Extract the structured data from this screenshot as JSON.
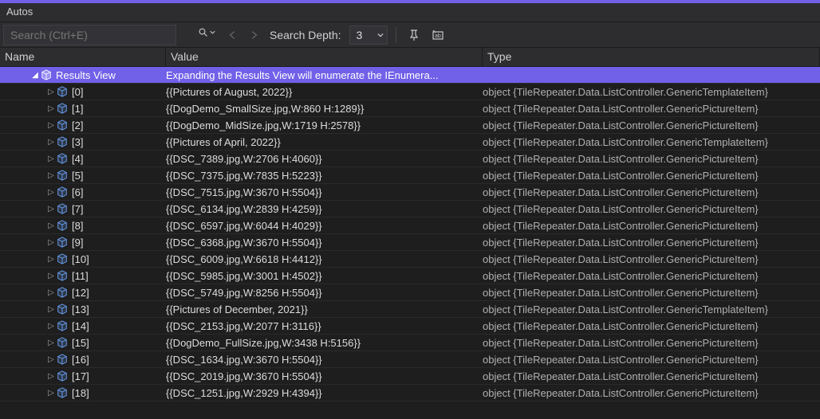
{
  "panel": {
    "title": "Autos"
  },
  "toolbar": {
    "search_placeholder": "Search (Ctrl+E)",
    "search_value": "",
    "depth_label": "Search Depth:",
    "depth_value": "3"
  },
  "columns": {
    "name": "Name",
    "value": "Value",
    "type": "Type"
  },
  "type_strings": {
    "template": "object {TileRepeater.Data.ListController.GenericTemplateItem}",
    "picture": "object {TileRepeater.Data.ListController.GenericPictureItem}"
  },
  "root": {
    "name": "Results View",
    "value": "Expanding the Results View will enumerate the IEnumera...",
    "type": "",
    "expanded": true
  },
  "items": [
    {
      "idx": "[0]",
      "value": "{{Pictures of August, 2022}}",
      "typekey": "template"
    },
    {
      "idx": "[1]",
      "value": "{{DogDemo_SmallSize.jpg,W:860 H:1289}}",
      "typekey": "picture"
    },
    {
      "idx": "[2]",
      "value": "{{DogDemo_MidSize.jpg,W:1719 H:2578}}",
      "typekey": "picture"
    },
    {
      "idx": "[3]",
      "value": "{{Pictures of April, 2022}}",
      "typekey": "template"
    },
    {
      "idx": "[4]",
      "value": "{{DSC_7389.jpg,W:2706 H:4060}}",
      "typekey": "picture"
    },
    {
      "idx": "[5]",
      "value": "{{DSC_7375.jpg,W:7835 H:5223}}",
      "typekey": "picture"
    },
    {
      "idx": "[6]",
      "value": "{{DSC_7515.jpg,W:3670 H:5504}}",
      "typekey": "picture"
    },
    {
      "idx": "[7]",
      "value": "{{DSC_6134.jpg,W:2839 H:4259}}",
      "typekey": "picture"
    },
    {
      "idx": "[8]",
      "value": "{{DSC_6597.jpg,W:6044 H:4029}}",
      "typekey": "picture"
    },
    {
      "idx": "[9]",
      "value": "{{DSC_6368.jpg,W:3670 H:5504}}",
      "typekey": "picture"
    },
    {
      "idx": "[10]",
      "value": "{{DSC_6009.jpg,W:6618 H:4412}}",
      "typekey": "picture"
    },
    {
      "idx": "[11]",
      "value": "{{DSC_5985.jpg,W:3001 H:4502}}",
      "typekey": "picture"
    },
    {
      "idx": "[12]",
      "value": "{{DSC_5749.jpg,W:8256 H:5504}}",
      "typekey": "picture"
    },
    {
      "idx": "[13]",
      "value": "{{Pictures of December, 2021}}",
      "typekey": "template"
    },
    {
      "idx": "[14]",
      "value": "{{DSC_2153.jpg,W:2077 H:3116}}",
      "typekey": "picture"
    },
    {
      "idx": "[15]",
      "value": "{{DogDemo_FullSize.jpg,W:3438 H:5156}}",
      "typekey": "picture"
    },
    {
      "idx": "[16]",
      "value": "{{DSC_1634.jpg,W:3670 H:5504}}",
      "typekey": "picture"
    },
    {
      "idx": "[17]",
      "value": "{{DSC_2019.jpg,W:3670 H:5504}}",
      "typekey": "picture"
    },
    {
      "idx": "[18]",
      "value": "{{DSC_1251.jpg,W:2929 H:4394}}",
      "typekey": "picture"
    }
  ]
}
